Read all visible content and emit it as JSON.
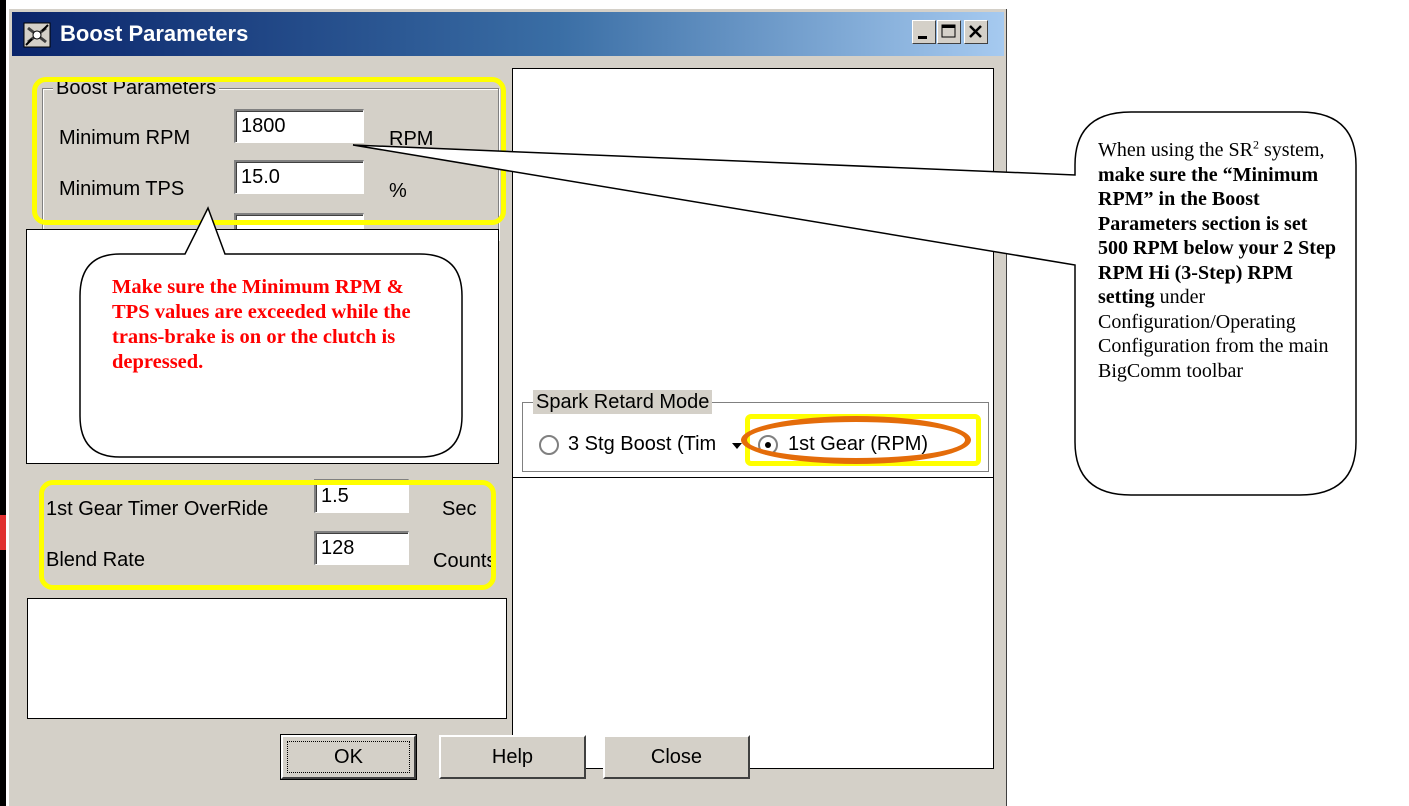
{
  "window": {
    "title": "Boost Parameters"
  },
  "boost_group": {
    "legend": "Boost Parameters",
    "min_rpm_label": "Minimum RPM",
    "min_rpm_value": "1800",
    "min_rpm_unit": "RPM",
    "min_tps_label": "Minimum TPS",
    "min_tps_value": "15.0",
    "min_tps_unit": "%"
  },
  "spark_group": {
    "legend": "Spark Retard Mode",
    "option_boost": "3 Stg Boost (Tim",
    "option_gear": "1st Gear (RPM)",
    "selected": "1st Gear (RPM)"
  },
  "gear_fields": {
    "timer_label": "1st Gear Timer OverRide",
    "timer_value": "1.5",
    "timer_unit": "Sec",
    "blend_label": "Blend Rate",
    "blend_value": "128",
    "blend_unit": "Counts"
  },
  "buttons": {
    "ok": "OK",
    "help": "Help",
    "close": "Close"
  },
  "callout_left": {
    "text": "Make sure the Minimum RPM & TPS values are exceeded while the trans-brake is on or the clutch is depressed."
  },
  "callout_right": {
    "t1": "When using the SR",
    "sup": "2",
    "t2": " system, ",
    "b1": "make sure the “Minimum RPM” in the Boost Parameters section is set 500 RPM below your 2 Step RPM Hi (3-Step) RPM setting",
    "t3": " under Configuration/Operating Configuration from the main BigComm toolbar"
  },
  "colors": {
    "highlight_yellow": "#ffff00",
    "highlight_orange": "#e46c0a",
    "callout_red_text": "#ff0000",
    "titlebar_dark": "#0a246a",
    "dialog_face": "#d4d0c8"
  }
}
